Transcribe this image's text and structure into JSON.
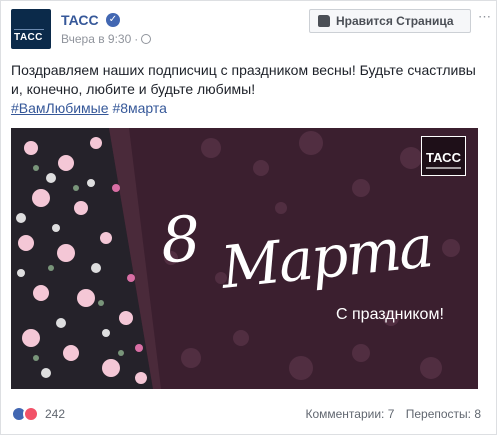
{
  "post": {
    "page_name": "ТАСС",
    "time": "Вчера в 9:30",
    "like_button": "Нравится Страница",
    "text_line1": "Поздравляем наших подписчиц с праздником весны! Будьте счастливы",
    "text_line2": "и, конечно, любите и будьте любимы!",
    "hashtag1": "#ВамЛюбимые",
    "hashtag2": "#8марта",
    "avatar_text": "ТАСС",
    "logo_text": "ТАСС"
  },
  "image": {
    "title_number": "8",
    "title_word": "Марта",
    "subtitle": "С праздником!"
  },
  "footer": {
    "reactions_count": "242",
    "comments": "Комментарии: 7",
    "shares": "Перепосты: 8"
  },
  "colors": {
    "link": "#365899",
    "bg_purple": "#3b1f2f",
    "like_blue": "#4267b2",
    "love_red": "#f25268"
  }
}
